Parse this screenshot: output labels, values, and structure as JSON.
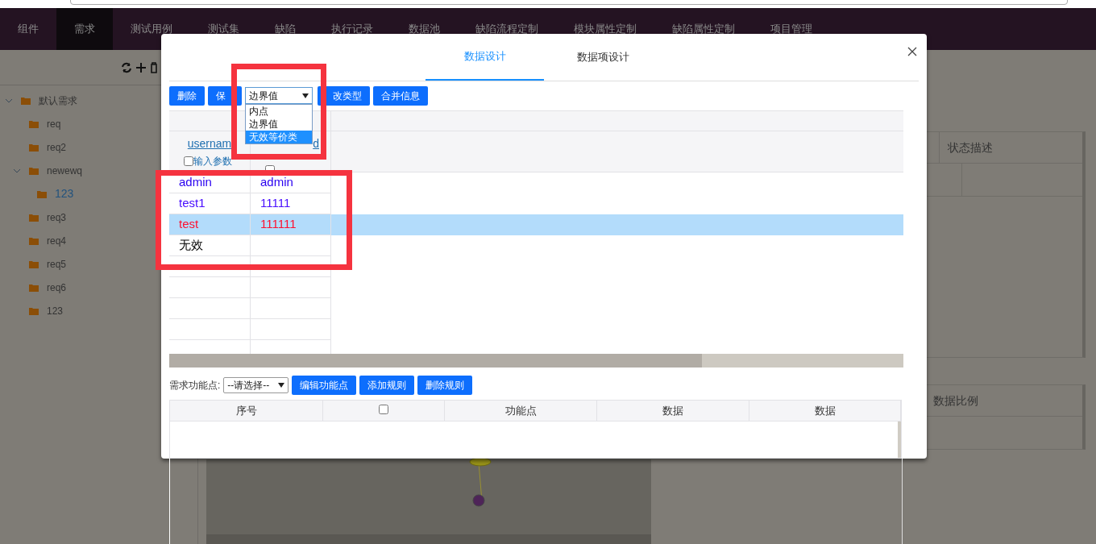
{
  "nav": [
    {
      "label": "组件",
      "selected": false
    },
    {
      "label": "需求",
      "selected": true
    },
    {
      "label": "测试用例",
      "selected": false
    },
    {
      "label": "测试集",
      "selected": false
    },
    {
      "label": "缺陷",
      "selected": false
    },
    {
      "label": "执行记录",
      "selected": false
    },
    {
      "label": "数据池",
      "selected": false
    },
    {
      "label": "缺陷流程定制",
      "selected": false
    },
    {
      "label": "模块属性定制",
      "selected": false
    },
    {
      "label": "缺陷属性定制",
      "selected": false
    },
    {
      "label": "项目管理",
      "selected": false
    }
  ],
  "tree": [
    {
      "label": "默认需求",
      "expanded": true,
      "selected": false,
      "children": [
        {
          "label": "req",
          "selected": false
        },
        {
          "label": "req2",
          "selected": false
        },
        {
          "label": "newewq",
          "expanded": true,
          "selected": false,
          "children": [
            {
              "label": "123",
              "selected": true
            }
          ]
        },
        {
          "label": "req3",
          "selected": false
        },
        {
          "label": "req4",
          "selected": false
        },
        {
          "label": "req5",
          "selected": false
        },
        {
          "label": "req6",
          "selected": false
        },
        {
          "label": "123",
          "selected": false
        }
      ]
    }
  ],
  "background_tables": [
    {
      "columns": [
        "状态描述"
      ]
    },
    {
      "columns": [
        "数据比例"
      ]
    }
  ],
  "dialog": {
    "tabs": [
      {
        "label": "数据设计",
        "selected": true
      },
      {
        "label": "数据项设计",
        "selected": false
      }
    ],
    "toolbar": [
      {
        "kind": "button",
        "label": "删除"
      },
      {
        "kind": "button",
        "label": "保"
      },
      {
        "kind": "select",
        "value": "边界值",
        "options": [
          {
            "label": "内点",
            "highlighted": false
          },
          {
            "label": "边界值",
            "highlighted": false
          },
          {
            "label": "无效等价类",
            "highlighted": true
          }
        ]
      },
      {
        "kind": "button",
        "label": "改类型"
      },
      {
        "kind": "button",
        "label": "合并信息"
      }
    ],
    "data_table": {
      "columns": [
        {
          "name": "usernam",
          "param_label": "输入参数",
          "checked": false
        },
        {
          "name": "d",
          "checked": false
        }
      ],
      "rows": [
        {
          "cells": [
            "admin",
            "admin"
          ],
          "color": "#2a00f0",
          "selected": false
        },
        {
          "cells": [
            "test1",
            "11111"
          ],
          "color": "#4a10ff",
          "selected": false
        },
        {
          "cells": [
            "test",
            "111111"
          ],
          "color": "#ff1030",
          "selected": true
        },
        {
          "cells": [
            "无效"
          ],
          "color": "#000000",
          "selected": false
        }
      ]
    },
    "rules": {
      "label": "需求功能点:",
      "select": "--请选择--",
      "buttons": [
        "编辑功能点",
        "添加规则",
        "删除规则"
      ],
      "columns": [
        {
          "kind": "text",
          "label": "序号"
        },
        {
          "kind": "checkbox",
          "checked": false
        },
        {
          "kind": "text",
          "label": "功能点"
        },
        {
          "kind": "text",
          "label": "数据"
        },
        {
          "kind": "text",
          "label": "数据"
        }
      ]
    }
  }
}
